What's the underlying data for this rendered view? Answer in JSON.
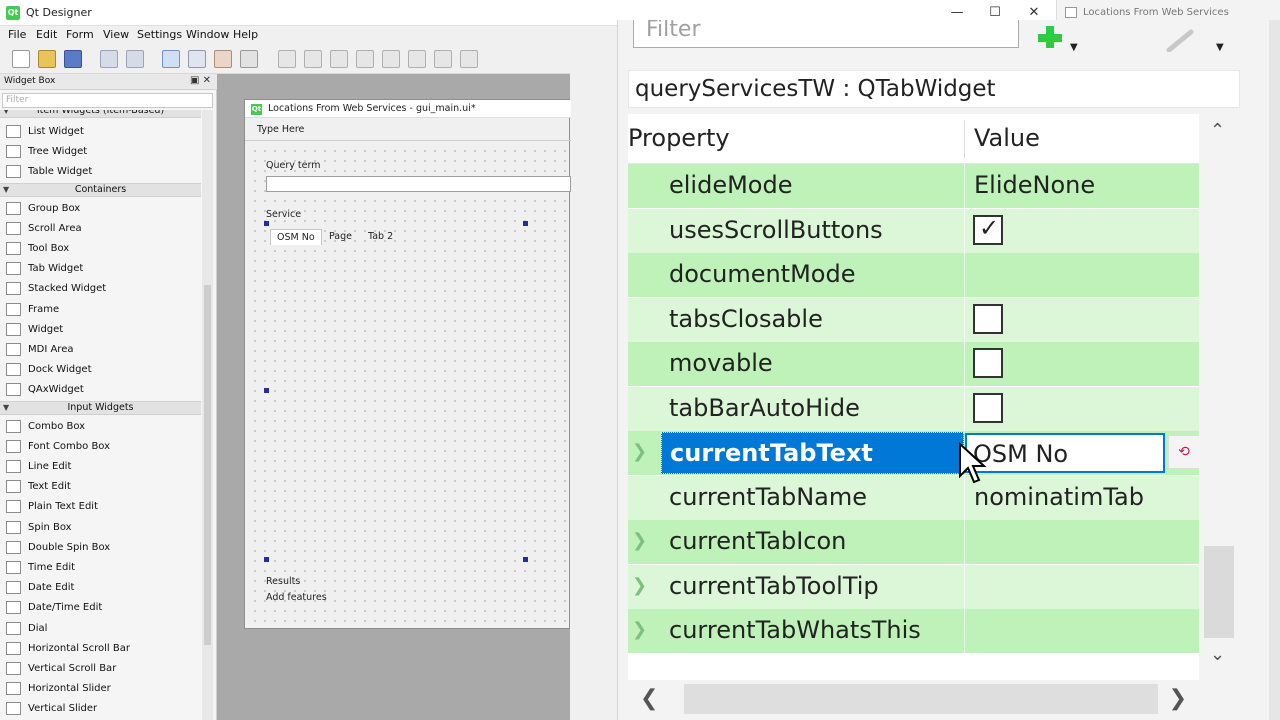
{
  "window": {
    "title": "Qt Designer",
    "other_window_title": "Locations From Web Services"
  },
  "menu": [
    "File",
    "Edit",
    "Form",
    "View",
    "Settings",
    "Window",
    "Help"
  ],
  "widget_box": {
    "title": "Widget Box",
    "filter_placeholder": "Filter",
    "categories": {
      "item_widgets": "Item Widgets (Item-Based)",
      "containers": "Containers",
      "input_widgets": "Input Widgets"
    },
    "item_widgets": [
      "List Widget",
      "Tree Widget",
      "Table Widget"
    ],
    "containers": [
      "Group Box",
      "Scroll Area",
      "Tool Box",
      "Tab Widget",
      "Stacked Widget",
      "Frame",
      "Widget",
      "MDI Area",
      "Dock Widget",
      "QAxWidget"
    ],
    "input_widgets": [
      "Combo Box",
      "Font Combo Box",
      "Line Edit",
      "Text Edit",
      "Plain Text Edit",
      "Spin Box",
      "Double Spin Box",
      "Time Edit",
      "Date Edit",
      "Date/Time Edit",
      "Dial",
      "Horizontal Scroll Bar",
      "Vertical Scroll Bar",
      "Horizontal Slider",
      "Vertical Slider"
    ]
  },
  "form": {
    "title": "Locations From Web Services - gui_main.ui*",
    "type_here": "Type Here",
    "query_label": "Query term",
    "service_label": "Service",
    "tabs": [
      "OSM No",
      "Page",
      "Tab 2"
    ],
    "results_label": "Results",
    "add_features_label": "Add features"
  },
  "property_editor": {
    "filter_placeholder": "Filter",
    "object": "queryServicesTW : QTabWidget",
    "header_property": "Property",
    "header_value": "Value",
    "rows": [
      {
        "name": "elideMode",
        "value": "ElideNone"
      },
      {
        "name": "usesScrollButtons",
        "value": "",
        "checked": true
      },
      {
        "name": "documentMode",
        "value": ""
      },
      {
        "name": "tabsClosable",
        "value": "",
        "checked": false
      },
      {
        "name": "movable",
        "value": "",
        "checked": false
      },
      {
        "name": "tabBarAutoHide",
        "value": "",
        "checked": false
      },
      {
        "name": "currentTabText",
        "value": "OSM No",
        "selected": true
      },
      {
        "name": "currentTabName",
        "value": "nominatimTab"
      },
      {
        "name": "currentTabIcon",
        "value": ""
      },
      {
        "name": "currentTabToolTip",
        "value": ""
      },
      {
        "name": "currentTabWhatsThis",
        "value": ""
      }
    ]
  },
  "colors": {
    "row_dark": "#bff2b8",
    "row_light": "#dbf7d7",
    "selection": "#0078d7"
  }
}
